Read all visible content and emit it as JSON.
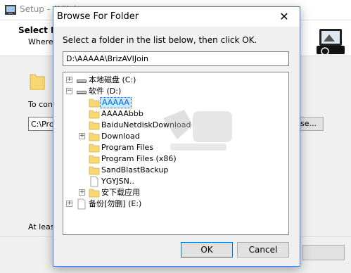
{
  "background_window": {
    "title": "Setup - AVIJoin",
    "header_title": "Select D",
    "header_subtitle": "Where",
    "to_continue_text": "To con",
    "path_value": "C:\\Pro",
    "browse_label": "se...",
    "at_least_text": "At least"
  },
  "dialog": {
    "title": "Browse For Folder",
    "close_glyph": "✕",
    "prompt": "Select a folder in the list below, then click OK.",
    "path_value": "D:\\AAAAA\\BrizAVIJoin",
    "ok_label": "OK",
    "cancel_label": "Cancel"
  },
  "tree": {
    "items": [
      {
        "label": "本地磁盘 (C:)",
        "icon": "drive-icon",
        "expander": "+",
        "selected": false
      },
      {
        "label": "软件 (D:)",
        "icon": "drive-icon",
        "expander": "−",
        "selected": false
      },
      {
        "label": "AAAAA",
        "icon": "folder-icon",
        "expander": "",
        "selected": true
      },
      {
        "label": "AAAAAbbb",
        "icon": "folder-icon",
        "expander": "",
        "selected": false
      },
      {
        "label": "BaiduNetdiskDownload",
        "icon": "folder-icon",
        "expander": "",
        "selected": false
      },
      {
        "label": "Download",
        "icon": "folder-icon",
        "expander": "+",
        "selected": false
      },
      {
        "label": "Program Files",
        "icon": "folder-icon",
        "expander": "",
        "selected": false
      },
      {
        "label": "Program Files (x86)",
        "icon": "folder-icon",
        "expander": "",
        "selected": false
      },
      {
        "label": "SandBlastBackup",
        "icon": "folder-icon",
        "expander": "",
        "selected": false
      },
      {
        "label": "YGYJSN..",
        "icon": "file-icon",
        "expander": "",
        "selected": false
      },
      {
        "label": "安下载应用",
        "icon": "folder-icon",
        "expander": "+",
        "selected": false
      },
      {
        "label": "备份[勿删] (E:)",
        "icon": "file-icon",
        "expander": "+",
        "selected": false
      }
    ]
  },
  "colors": {
    "accent": "#0078d7",
    "folder": "#f8d775",
    "selection_bg": "#cce8ff",
    "selection_text": "#0066cc"
  }
}
